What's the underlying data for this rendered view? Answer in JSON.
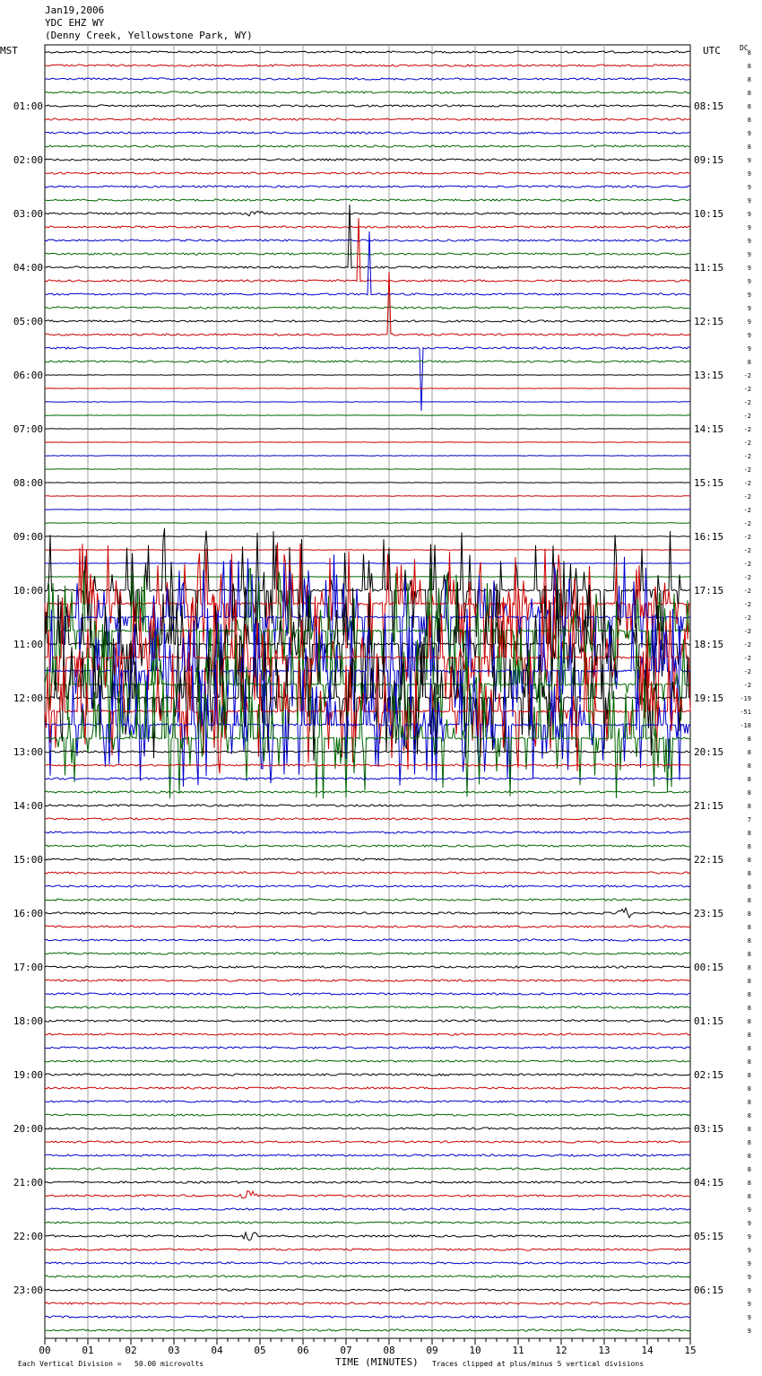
{
  "header": {
    "date": "Jan19,2006",
    "station": "YDC EHZ WY",
    "location": "(Denny Creek, Yellowstone Park, WY)"
  },
  "left_axis_title": "MST",
  "right_axis_title": "UTC",
  "dc_title": "DC",
  "footer": {
    "scale_note": "Each Vertical Division =   50.00 microvolts",
    "xlabel": "TIME (MINUTES)",
    "clip_note": "Traces clipped at plus/minus 5 vertical divisions"
  },
  "colors": {
    "trace_cycle": [
      "#000000",
      "#cc0000",
      "#0000cc",
      "#006600"
    ],
    "grid": "#a0a0a0",
    "axis": "#000000"
  },
  "chart_data": {
    "type": "line",
    "title": "Jan19,2006 YDC EHZ WY (Denny Creek, Yellowstone Park, WY)",
    "xlabel": "TIME (MINUTES)",
    "xlim": [
      0,
      15
    ],
    "x_ticks": [
      "00",
      "01",
      "02",
      "03",
      "04",
      "05",
      "06",
      "07",
      "08",
      "09",
      "10",
      "11",
      "12",
      "13",
      "14",
      "15"
    ],
    "traces_per_hour": 4,
    "trace_count": 96,
    "mst_hour_labels": [
      "",
      "01:00",
      "02:00",
      "03:00",
      "04:00",
      "05:00",
      "06:00",
      "07:00",
      "08:00",
      "09:00",
      "10:00",
      "11:00",
      "12:00",
      "13:00",
      "14:00",
      "15:00",
      "16:00",
      "17:00",
      "18:00",
      "19:00",
      "20:00",
      "21:00",
      "22:00",
      "23:00"
    ],
    "utc_hour_labels": [
      "",
      "08:15",
      "09:15",
      "10:15",
      "11:15",
      "12:15",
      "13:15",
      "14:15",
      "15:15",
      "16:15",
      "17:15",
      "18:15",
      "19:15",
      "20:15",
      "21:15",
      "22:15",
      "23:15",
      "00:15",
      "01:15",
      "02:15",
      "03:15",
      "04:15",
      "05:15",
      "06:15"
    ],
    "dc_offsets": [
      "8",
      "8",
      "8",
      "8",
      "8",
      "8",
      "9",
      "8",
      "9",
      "9",
      "9",
      "9",
      "9",
      "9",
      "9",
      "9",
      "9",
      "9",
      "9",
      "9",
      "9",
      "9",
      "9",
      "8",
      "-2",
      "-2",
      "-2",
      "-2",
      "-2",
      "-2",
      "-2",
      "-2",
      "-2",
      "-2",
      "-2",
      "-2",
      "-2",
      "-2",
      "-2",
      "-2",
      "-2",
      "-2",
      "-2",
      "-2",
      "-2",
      "-2",
      "-2",
      "-2",
      "-19",
      "-51",
      "-18",
      "8",
      "8",
      "8",
      "8",
      "8",
      "8",
      "7",
      "8",
      "8",
      "8",
      "8",
      "8",
      "8",
      "8",
      "8",
      "8",
      "8",
      "8",
      "8",
      "8",
      "8",
      "8",
      "8",
      "8",
      "8",
      "8",
      "8",
      "8",
      "8",
      "8",
      "8",
      "8",
      "8",
      "8",
      "8",
      "9",
      "9",
      "9",
      "9",
      "9",
      "9",
      "9",
      "9",
      "9",
      "9"
    ],
    "disturbed_traces": [
      40,
      41,
      42,
      43,
      44,
      45,
      46,
      47,
      48,
      49,
      50,
      51
    ],
    "events": [
      {
        "trace": 12,
        "minute": 4.9
      },
      {
        "trace": 85,
        "minute": 4.75
      },
      {
        "trace": 88,
        "minute": 4.75
      },
      {
        "trace": 64,
        "minute": 13.5
      }
    ],
    "spikes": [
      {
        "trace": 16,
        "minute": 7.1
      },
      {
        "trace": 17,
        "minute": 7.3
      },
      {
        "trace": 18,
        "minute": 7.55
      },
      {
        "trace": 21,
        "minute": 8.0
      },
      {
        "trace": 22,
        "minute": 8.75
      }
    ]
  }
}
